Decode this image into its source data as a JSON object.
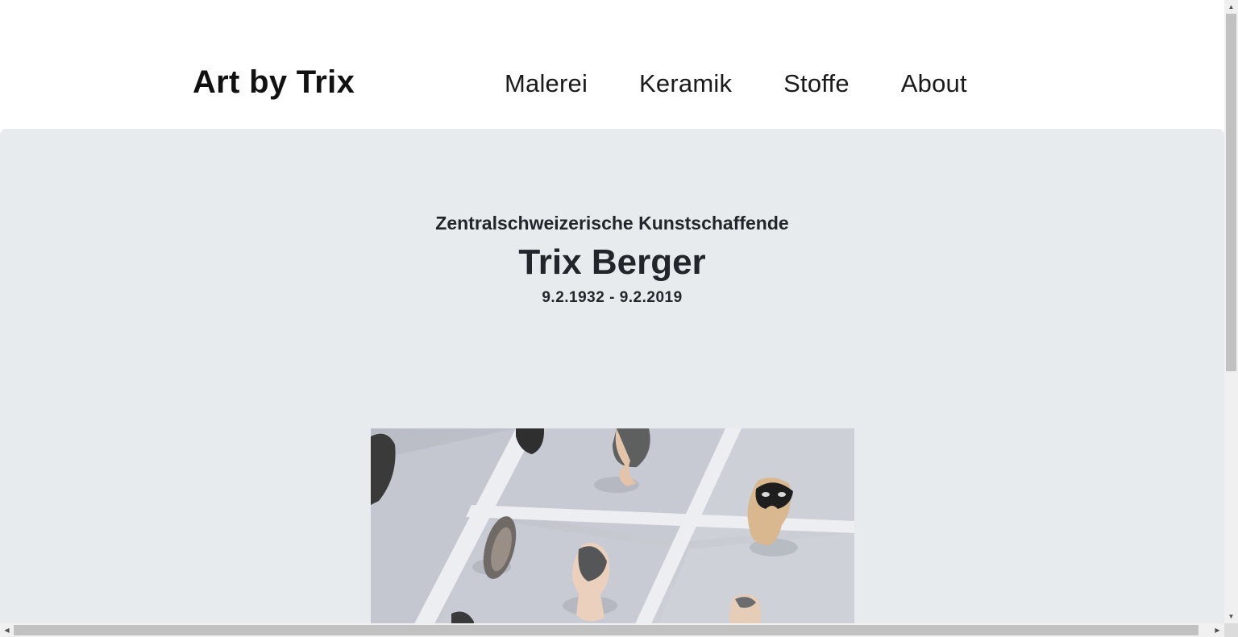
{
  "header": {
    "brand": "Art by Trix",
    "nav": [
      {
        "label": "Malerei"
      },
      {
        "label": "Keramik"
      },
      {
        "label": "Stoffe"
      },
      {
        "label": "About"
      }
    ]
  },
  "hero": {
    "subtitle": "Zentralschweizerische Kunstschaffende",
    "name": "Trix Berger",
    "dates": "9.2.1932 - 9.2.2019"
  },
  "colors": {
    "hero_background": "#e8ebed",
    "text_dark": "#222529"
  },
  "scrollbar": {
    "up_icon": "triangle-up-icon",
    "down_icon": "triangle-down-icon",
    "left_icon": "triangle-left-icon",
    "right_icon": "triangle-right-icon"
  }
}
